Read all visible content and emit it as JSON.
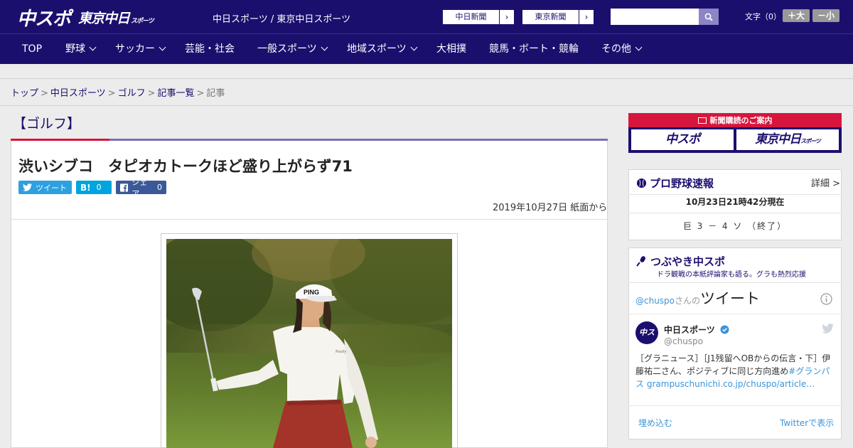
{
  "header": {
    "logo_chuspo": "中スポ",
    "logo_tokyo": "東京中日",
    "logo_tokyo_sub": "スポーツ",
    "tagline": "中日スポーツ / 東京中日スポーツ",
    "paper_links": [
      "中日新聞",
      "東京新聞"
    ],
    "search_placeholder": "",
    "font_label": "文字（0）",
    "font_plus": "＋大",
    "font_minus": "－小"
  },
  "nav": {
    "items": [
      {
        "label": "TOP"
      },
      {
        "label": "野球"
      },
      {
        "label": "サッカー"
      },
      {
        "label": "芸能・社会"
      },
      {
        "label": "一般スポーツ"
      },
      {
        "label": "地域スポーツ"
      },
      {
        "label": "大相撲"
      },
      {
        "label": "競馬・ボート・競輪"
      },
      {
        "label": "その他"
      }
    ]
  },
  "breadcrumb": {
    "items": [
      "トップ",
      "中日スポーツ",
      "ゴルフ",
      "記事一覧"
    ],
    "current": "記事",
    "separator": ">"
  },
  "article": {
    "category": "【ゴルフ】",
    "headline": "渋いシブコ　タピオカトークほど盛り上がらず71",
    "share": {
      "tweet_label": "ツイート",
      "hatena_label": "B!",
      "hatena_count": "0",
      "facebook_label": "シェア",
      "facebook_count": "0"
    },
    "date": "2019年10月27日 紙面から",
    "photo_alt": "渋いシブコ"
  },
  "sidebar": {
    "subscribe": {
      "title": "新聞購読のご案内",
      "logo_chuspo": "中スポ",
      "logo_tokyo": "東京中日",
      "logo_tokyo_sub": "スポーツ"
    },
    "baseball": {
      "title": "プロ野球速報",
      "detail": "詳細 >",
      "updated": "10月23日21時42分現在",
      "score": "巨 3 － 4 ソ （終了）"
    },
    "twitter": {
      "title": "つぶやき中スポ",
      "subtitle": "ドラ観戦の本紙評論家も語る。グラも熱烈応援",
      "handle_prefix": "@chuspo",
      "handle_suffix": "さんの",
      "heading": "ツイート",
      "account_name": "中日スポーツ",
      "account_handle": "@chuspo",
      "avatar_text": "中スポ",
      "tweet_text": "［グラニュース］［J1残留へOBからの伝言・下］伊藤祐二さん、ポジティブに同じ方向進め",
      "tweet_hashtag": "#グランパス",
      "tweet_link": "grampuschunichi.co.jp/chuspo/article…",
      "embed_label": "埋め込む",
      "view_label": "Twitterで表示"
    }
  },
  "colors": {
    "brand": "#1b0f6e",
    "accent_red": "#d7163d",
    "twitter_blue": "#3b94d9"
  }
}
